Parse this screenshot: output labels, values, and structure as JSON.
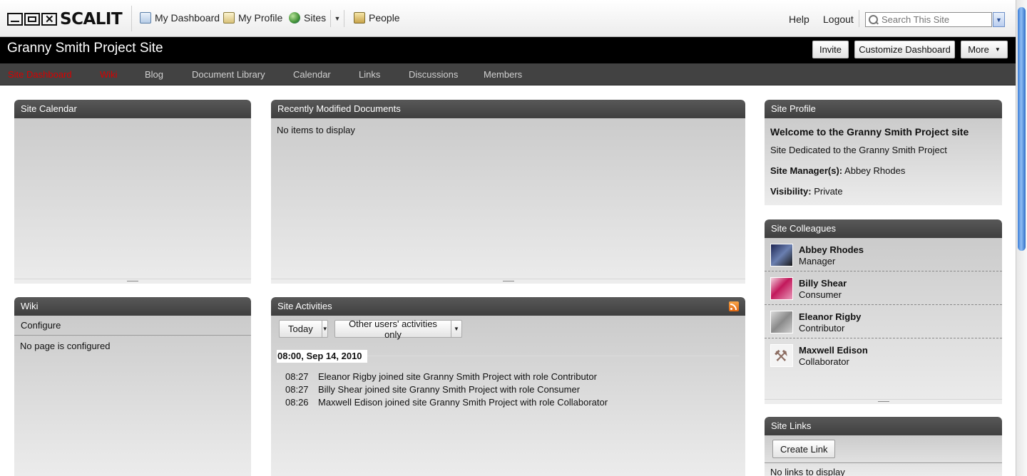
{
  "brand": {
    "logo_text": "SCALIT"
  },
  "topnav": {
    "my_dashboard": "My Dashboard",
    "my_profile": "My Profile",
    "sites": "Sites",
    "people": "People",
    "help": "Help",
    "logout": "Logout",
    "search_placeholder": "Search This Site"
  },
  "site": {
    "title": "Granny Smith Project Site",
    "buttons": {
      "invite": "Invite",
      "customize": "Customize Dashboard",
      "more": "More"
    }
  },
  "tabs": [
    {
      "label": "Site Dashboard",
      "active": true
    },
    {
      "label": "Wiki",
      "active": true
    },
    {
      "label": "Blog",
      "active": false
    },
    {
      "label": "Document Library",
      "active": false
    },
    {
      "label": "Calendar",
      "active": false
    },
    {
      "label": "Links",
      "active": false
    },
    {
      "label": "Discussions",
      "active": false
    },
    {
      "label": "Members",
      "active": false
    }
  ],
  "dashlets": {
    "calendar": {
      "title": "Site Calendar"
    },
    "recent_docs": {
      "title": "Recently Modified Documents",
      "empty": "No items to display"
    },
    "wiki": {
      "title": "Wiki",
      "configure": "Configure",
      "empty": "No page is configured"
    },
    "activities": {
      "title": "Site Activities",
      "range_filter": "Today",
      "user_filter": "Other users' activities only",
      "date": "08:00, Sep 14, 2010",
      "items": [
        {
          "time": "08:27",
          "text": "Eleanor Rigby joined site Granny Smith Project with role Contributor"
        },
        {
          "time": "08:27",
          "text": "Billy Shear joined site Granny Smith Project with role Consumer"
        },
        {
          "time": "08:26",
          "text": "Maxwell Edison joined site Granny Smith Project with role Collaborator"
        }
      ]
    },
    "profile": {
      "title": "Site Profile",
      "welcome": "Welcome to the Granny Smith Project site",
      "description": "Site Dedicated to the Granny Smith Project",
      "manager_label": "Site Manager(s):",
      "manager_value": "Abbey Rhodes",
      "visibility_label": "Visibility:",
      "visibility_value": "Private"
    },
    "colleagues": {
      "title": "Site Colleagues",
      "members": [
        {
          "name": "Abbey Rhodes",
          "role": "Manager",
          "avatar_color": "#3a3f6a"
        },
        {
          "name": "Billy Shear",
          "role": "Consumer",
          "avatar_color": "#c2185b"
        },
        {
          "name": "Eleanor Rigby",
          "role": "Contributor",
          "avatar_color": "#9a9a9a"
        },
        {
          "name": "Maxwell Edison",
          "role": "Collaborator",
          "avatar_color": "#8d6e63"
        }
      ]
    },
    "links": {
      "title": "Site Links",
      "create": "Create Link",
      "empty": "No links to display"
    }
  }
}
